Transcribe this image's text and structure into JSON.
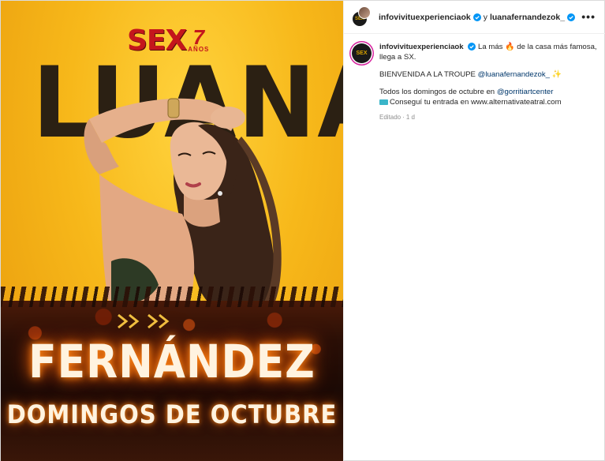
{
  "poster": {
    "logo_text": "SEX",
    "logo_years": "7",
    "logo_years_word": "AÑOS",
    "first_name": "LUANA",
    "last_name": "FERNÁNDEZ",
    "subtitle": "DOMINGOS DE OCTUBRE"
  },
  "header": {
    "user1": "infovivituexperienciaok",
    "joiner": "y",
    "user2": "luanafernandezok_",
    "more_icon": "•••"
  },
  "caption": {
    "username": "infovivituexperienciaok",
    "line1_a": "La más",
    "line1_emoji": "🔥",
    "line1_b": "de la casa más famosa, llega a SX.",
    "line2_a": "BIENVENIDA A LA TROUPE",
    "line2_mention": "@luanafernandezok_",
    "line2_emoji": "✨",
    "line3_a": "Todos los domingos de octubre en",
    "line3_mention": "@gorritiartcenter",
    "line4": "Conseguí tu entrada en www.alternativateatral.com",
    "meta_edited": "Editado",
    "meta_dot": "·",
    "meta_time": "1 d"
  },
  "colors": {
    "verified": "#0095f6",
    "mention": "#00376b",
    "poster_yellow": "#f7b81a"
  }
}
